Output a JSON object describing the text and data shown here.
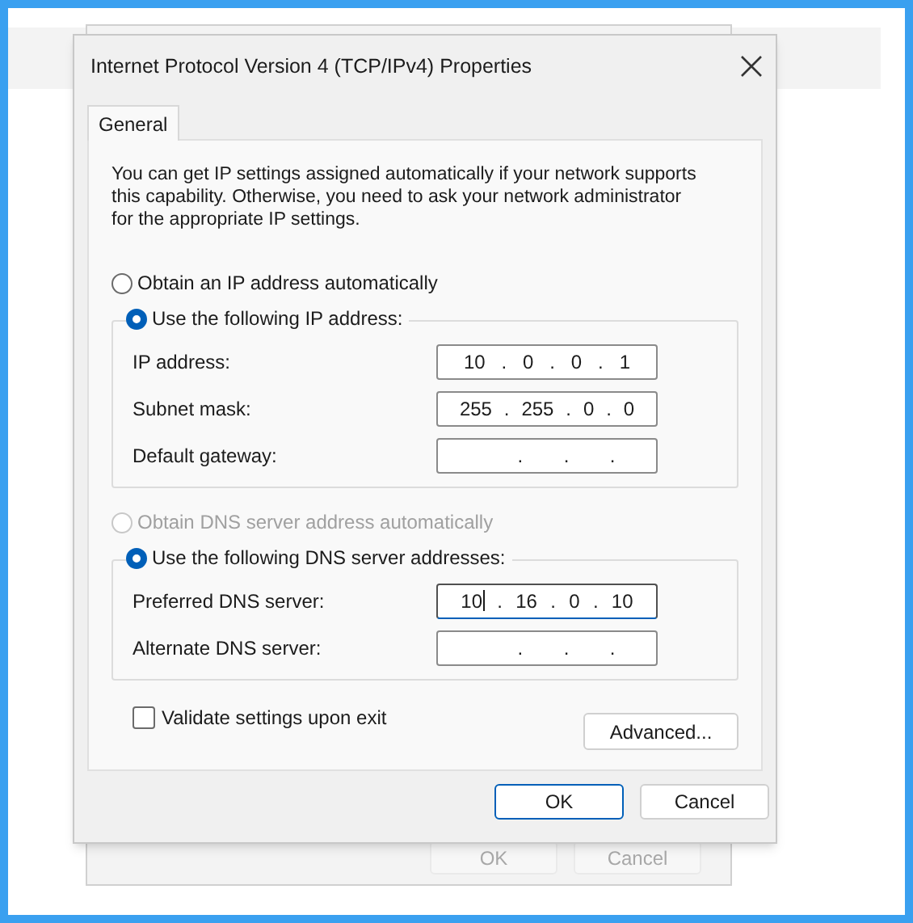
{
  "background_window": {
    "buttons": [
      {
        "label": "OK",
        "disabled": true
      },
      {
        "label": "Cancel",
        "disabled": true
      }
    ]
  },
  "dialog": {
    "title": "Internet Protocol Version 4 (TCP/IPv4) Properties",
    "tabs": [
      {
        "label": "General",
        "selected": true
      }
    ],
    "description": "You can get IP settings assigned automatically if your network supports this capability. Otherwise, you need to ask your network administrator for the appropriate IP settings.",
    "ip_options": [
      {
        "label": "Obtain an IP address automatically",
        "selected": false,
        "disabled": false
      },
      {
        "label": "Use the following IP address:",
        "selected": true,
        "disabled": false
      }
    ],
    "ip_fields": [
      {
        "label": "IP address:",
        "parts": [
          "10",
          ".",
          "0",
          ".",
          "0",
          ".",
          "1"
        ],
        "focused": false
      },
      {
        "label": "Subnet mask:",
        "parts": [
          "255",
          ".",
          "255",
          ".",
          "0",
          ".",
          "0"
        ],
        "focused": false
      },
      {
        "label": "Default gateway:",
        "parts": [
          ".",
          ".",
          "."
        ],
        "focused": false
      }
    ],
    "dns_options": [
      {
        "label": "Obtain DNS server address automatically",
        "selected": false,
        "disabled": true
      },
      {
        "label": "Use the following DNS server addresses:",
        "selected": true,
        "disabled": false
      }
    ],
    "dns_fields": [
      {
        "label": "Preferred DNS server:",
        "parts": [
          "10",
          ".",
          "16",
          ".",
          "0",
          ".",
          "10"
        ],
        "focused": true
      },
      {
        "label": "Alternate DNS server:",
        "parts": [
          ".",
          ".",
          "."
        ],
        "focused": false
      }
    ],
    "validate": {
      "label": "Validate settings upon exit",
      "checked": false
    },
    "advanced_button": "Advanced...",
    "buttons": [
      {
        "label": "OK",
        "default": true
      },
      {
        "label": "Cancel",
        "default": false
      }
    ]
  }
}
